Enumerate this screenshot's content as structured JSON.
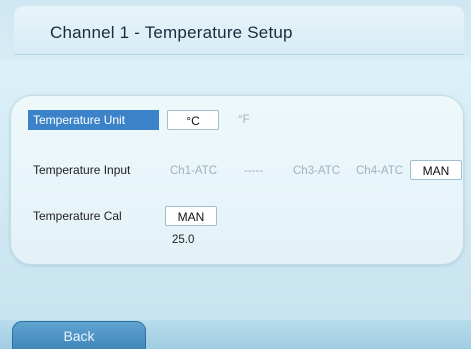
{
  "header": {
    "title": "Channel 1 - Temperature Setup"
  },
  "temperature_unit": {
    "label": "Temperature Unit",
    "options": [
      "°C",
      "°F"
    ],
    "selected": "°C"
  },
  "temperature_input": {
    "label": "Temperature Input",
    "options": [
      "Ch1-ATC",
      "-----",
      "Ch3-ATC",
      "Ch4-ATC",
      "MAN"
    ],
    "selected": "MAN"
  },
  "temperature_cal": {
    "label": "Temperature Cal",
    "mode": "MAN",
    "value": "25.0"
  },
  "footer": {
    "back_label": "Back"
  },
  "colors": {
    "selected_label_bg": "#3c82c8",
    "inactive_option": "#9fb3be",
    "back_button": "#4a90c2"
  }
}
